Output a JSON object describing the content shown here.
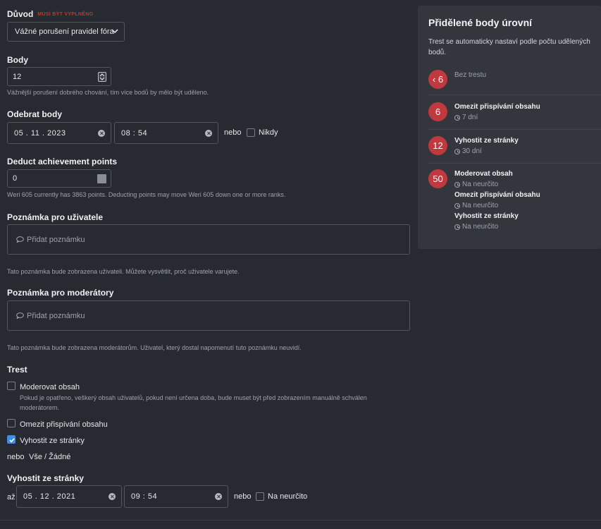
{
  "reason": {
    "label": "Důvod",
    "required": "MUSÍ BÝT VYPLNĚNO",
    "selected": "Vážné porušení pravidel fóra"
  },
  "points": {
    "label": "Body",
    "value": "12",
    "hint": "Vážnější porušení dobrého chování, tím více bodů by mělo být uděleno."
  },
  "expire": {
    "label": "Odebrat body",
    "date": "05 . 11 . 2023",
    "time": "08 : 54",
    "or": "nebo",
    "never": "Nikdy"
  },
  "achievement": {
    "label": "Deduct achievement points",
    "value": "0",
    "hint": "Weri 605 currently has 3863 points. Deducting points may move Weri 605 down one or more ranks."
  },
  "user_note": {
    "label": "Poznámka pro uživatele",
    "placeholder": "Přidat poznámku",
    "hint": "Tato poznámka bude zobrazena uživateli. Můžete vysvětlit, proč uživatele varujete."
  },
  "mod_note": {
    "label": "Poznámka pro moderátory",
    "placeholder": "Přidat poznámku",
    "hint": "Tato poznámka bude zobrazena moderátorům. Uživatel, který dostal napomenutí tuto poznámku neuvidí."
  },
  "punishment": {
    "label": "Trest",
    "options": [
      {
        "label": "Moderovat obsah",
        "checked": false,
        "desc_1": "Pokud je opatřeno, veškerý obsah uživatelů, pokud není určena doba, bude muset být před zobrazením manuálně schválen",
        "desc_2": "moderátorem."
      },
      {
        "label": "Omezit přispívání obsahu",
        "checked": false
      },
      {
        "label": "Vyhostit ze stránky",
        "checked": true
      }
    ],
    "or": "nebo",
    "all_none": "Vše / Žádné"
  },
  "ban": {
    "label": "Vyhostit ze stránky",
    "until": "až",
    "date": "05 . 12 . 2021",
    "time": "09 : 54",
    "or": "nebo",
    "indefinite": "Na neurčito"
  },
  "sidebar": {
    "title": "Přidělené body úrovní",
    "desc": "Trest se automaticky nastaví podle počtu udělených bodů.",
    "levels": [
      {
        "badge": "‹ 6",
        "entries": [
          {
            "name": "Bez trestu",
            "dur": ""
          }
        ]
      },
      {
        "badge": "6",
        "entries": [
          {
            "name": "Omezit přispívání obsahu",
            "dur": "7 dní"
          }
        ]
      },
      {
        "badge": "12",
        "entries": [
          {
            "name": "Vyhostit ze stránky",
            "dur": "30 dní"
          }
        ]
      },
      {
        "badge": "50",
        "entries": [
          {
            "name": "Moderovat obsah",
            "dur": "Na neurčito"
          },
          {
            "name": "Omezit přispívání obsahu",
            "dur": "Na neurčito"
          },
          {
            "name": "Vyhostit ze stránky",
            "dur": "Na neurčito"
          }
        ]
      }
    ]
  },
  "colors": {
    "accent": "#3b8fe4",
    "badge": "#c0393f",
    "required": "#c0392b"
  }
}
